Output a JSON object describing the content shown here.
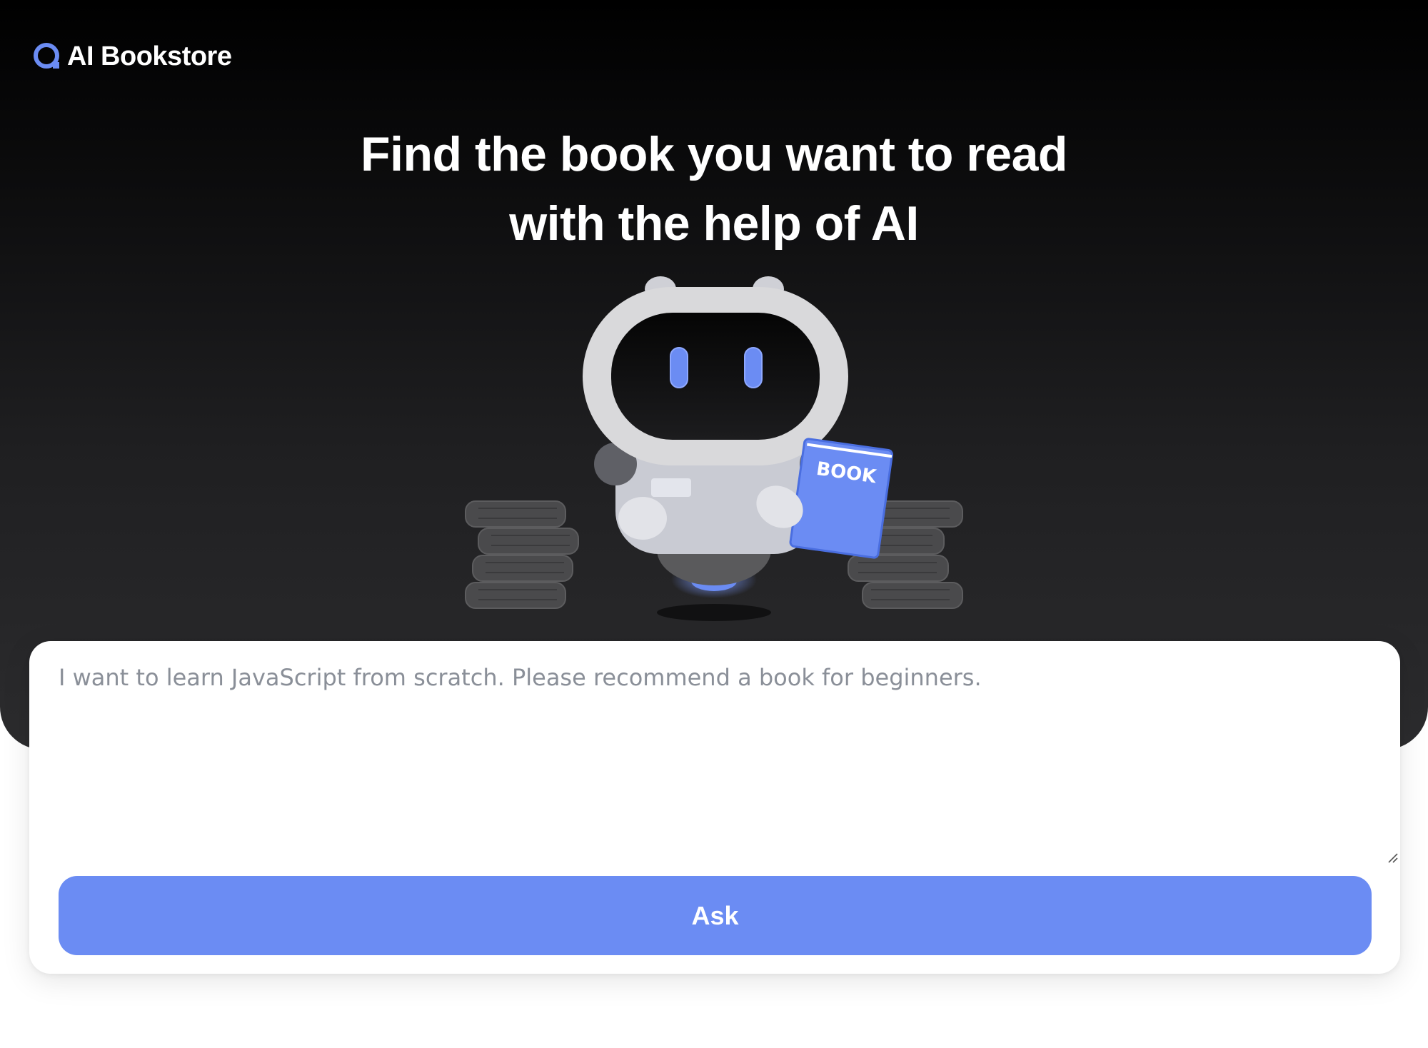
{
  "brand": {
    "name": "AI Bookstore",
    "logo_icon": "search-circle-icon",
    "accent_color": "#6b8cf3"
  },
  "hero": {
    "headline_line1": "Find the book you want to read",
    "headline_line2": "with the help of AI",
    "illustration": "robot-reading-book",
    "book_label": "BOOK"
  },
  "form": {
    "question_placeholder": "I want to learn JavaScript from scratch. Please recommend a book for beginners.",
    "question_value": "",
    "ask_label": "Ask"
  }
}
